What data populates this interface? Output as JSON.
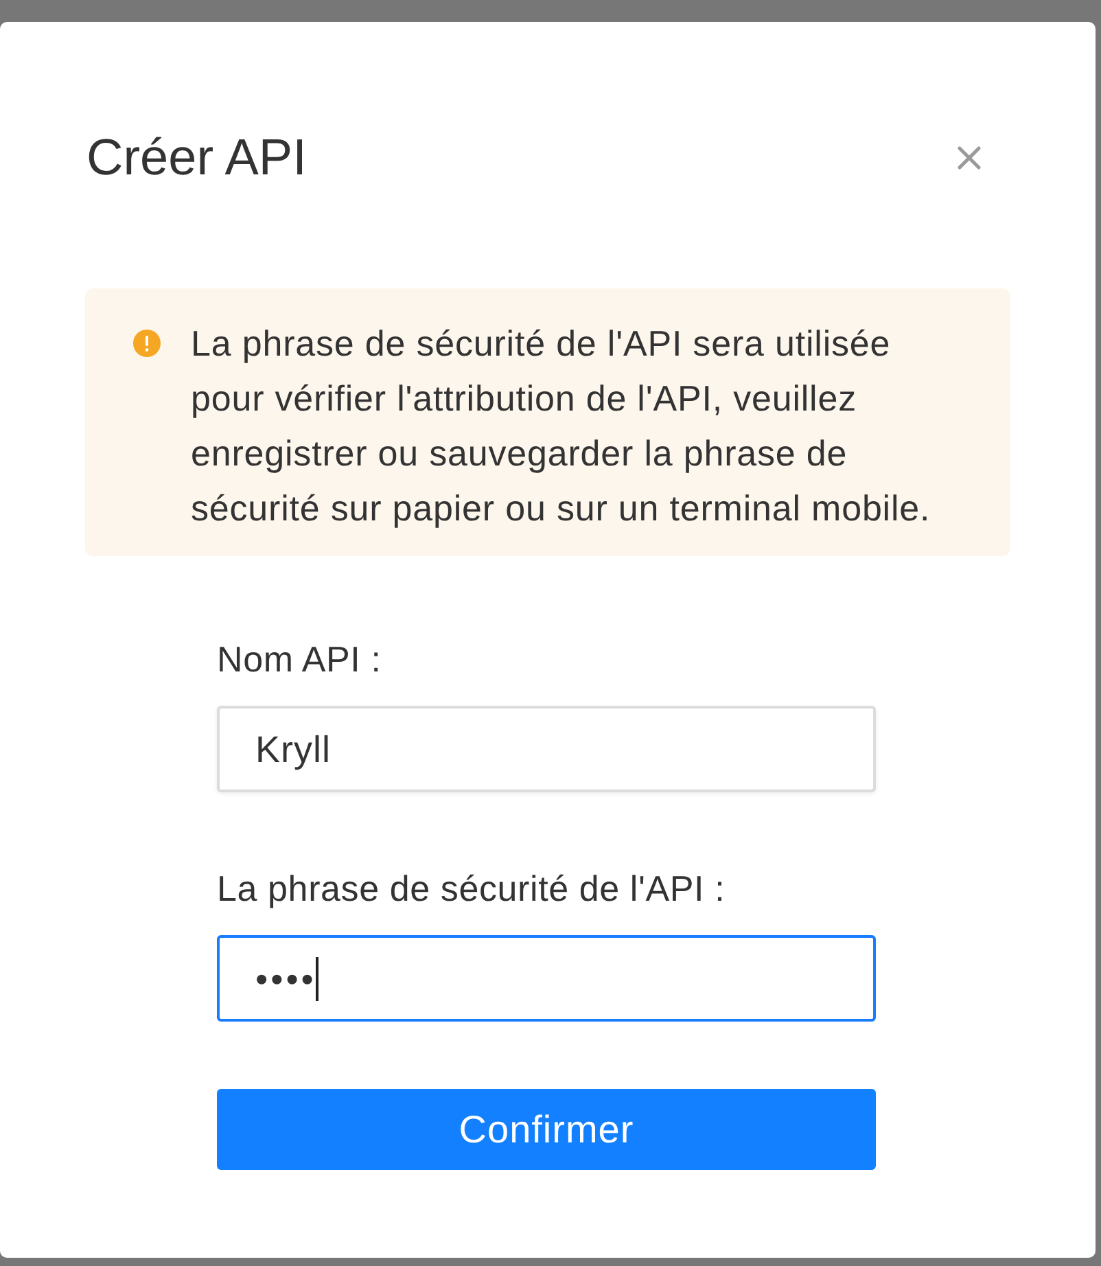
{
  "dialog": {
    "title": "Créer API"
  },
  "notice": {
    "kind": "warning",
    "text": "La phrase de sécurité de l'API sera utilisée pour vérifier l'attribution de l'API, veuillez enregistrer ou sauvegarder la phrase de sécurité sur papier ou sur un terminal mobile."
  },
  "fields": [
    {
      "kind": "text",
      "label": "Nom API :",
      "value": "Kryll",
      "focused": false
    },
    {
      "kind": "password",
      "label": "La phrase de sécurité de l'API :",
      "value": "••••",
      "focused": true
    }
  ],
  "submit": {
    "label": "Confirmer"
  }
}
